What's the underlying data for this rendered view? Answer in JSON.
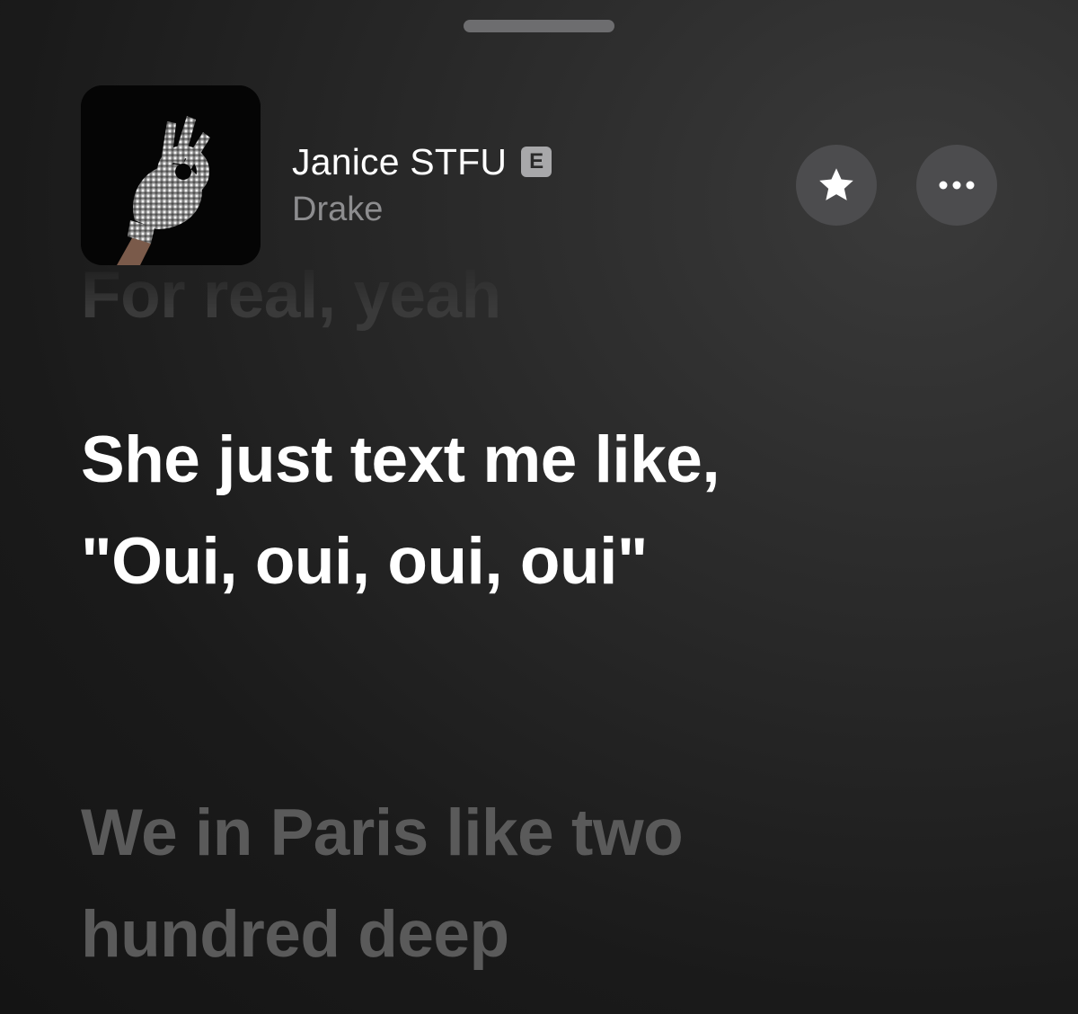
{
  "header": {
    "grabber": "sheet-grabber"
  },
  "track": {
    "title": "Janice STFU",
    "explicit_badge": "E",
    "artist": "Drake",
    "artwork_icon": "ok-hand-glove-artwork"
  },
  "actions": {
    "favorite_icon": "star-icon",
    "more_icon": "ellipsis-icon"
  },
  "lyrics": {
    "previous": "For real, yeah",
    "current": "She just text me like, \"Oui, oui, oui, oui\"",
    "next": "We in Paris like two hundred deep"
  },
  "colors": {
    "current_lyric": "#ffffff",
    "upcoming_lyric": "#5a5a5a",
    "button_bg": "#4c4c4e"
  }
}
